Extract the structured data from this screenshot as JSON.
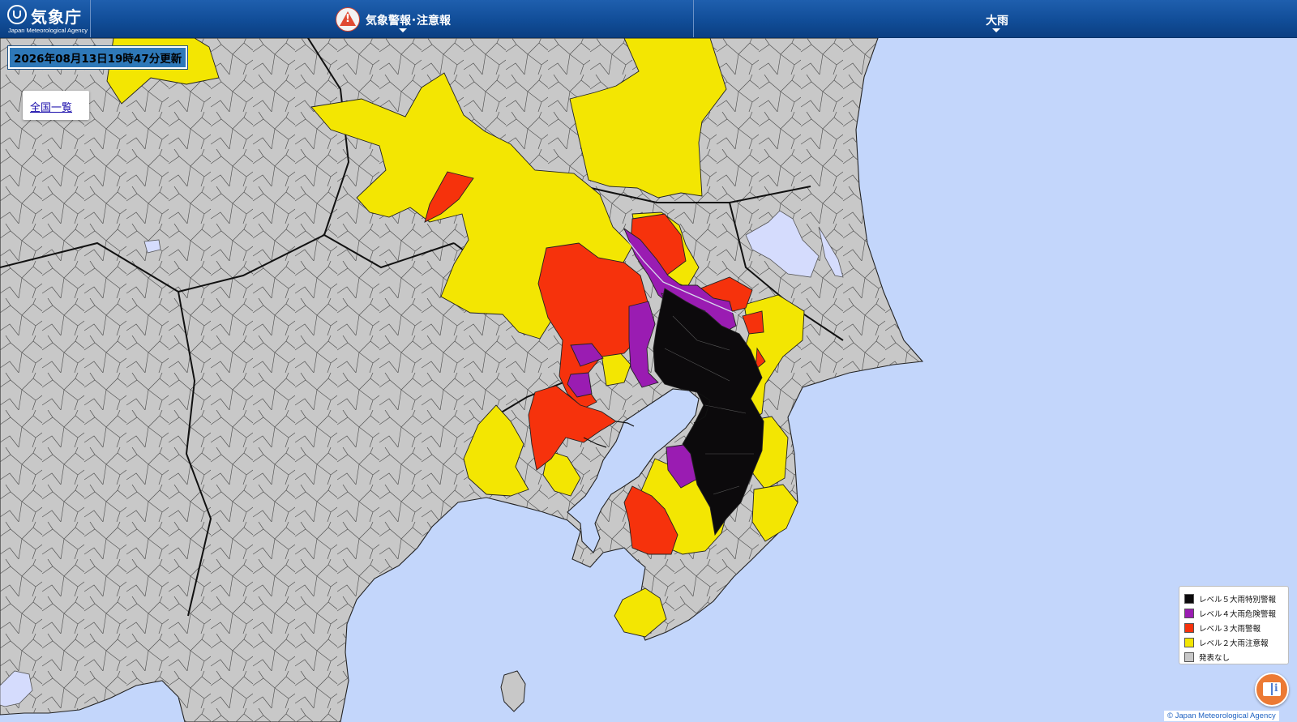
{
  "header": {
    "logo_jp": "気象庁",
    "logo_en": "Japan Meteorological Agency",
    "warning_selector_label": "気象警報･注意報",
    "element_selector_label": "大雨"
  },
  "map": {
    "updated_text": "2026年08月13日19時47分更新",
    "national_list_link": "全国一覧",
    "copyright": "© Japan Meteorological Agency",
    "colors": {
      "sea": "#c3d6fb",
      "land_none": "#c8c8c8",
      "lake": "#d5dcfd",
      "level5": "#0c0a0c",
      "level4": "#9a1cb2",
      "level3": "#f6320c",
      "level2": "#f3e602"
    }
  },
  "legend": {
    "items": [
      {
        "label": "レベル５大雨特別警報",
        "color": "#0c0a0c"
      },
      {
        "label": "レベル４大雨危険警報",
        "color": "#9a1cb2"
      },
      {
        "label": "レベル３大雨警報",
        "color": "#f6320c"
      },
      {
        "label": "レベル２大雨注意報",
        "color": "#f3e602"
      },
      {
        "label": "発表なし",
        "color": "#c8c8c8"
      }
    ]
  }
}
